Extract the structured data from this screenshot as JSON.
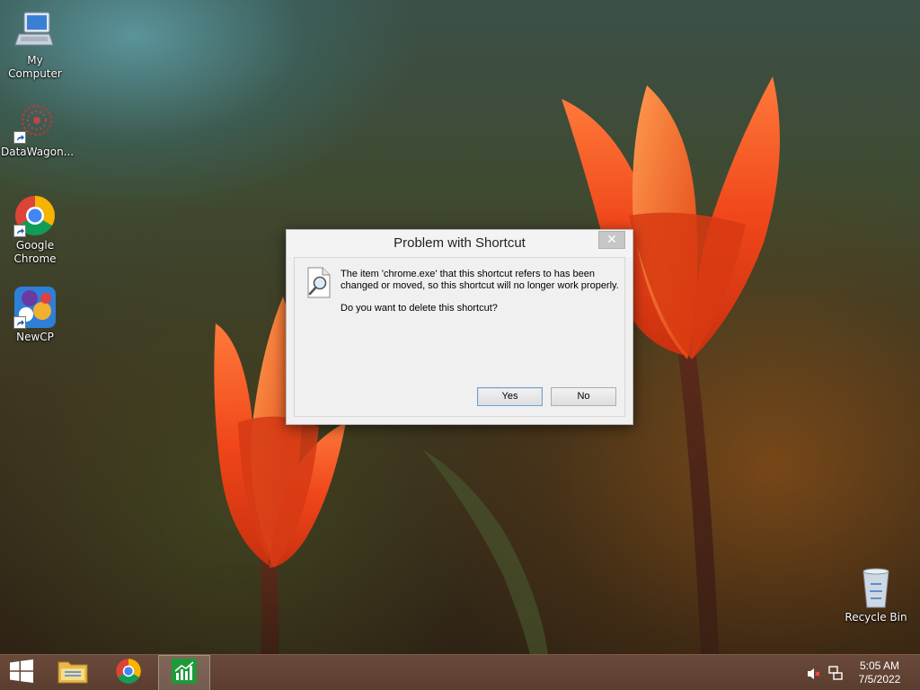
{
  "desktop": {
    "icons": [
      {
        "label": "My Computer",
        "icon": "computer-icon"
      },
      {
        "label": "DataWagon...",
        "icon": "datawagon-icon"
      },
      {
        "label": "Google Chrome",
        "icon": "chrome-icon"
      },
      {
        "label": "NewCP",
        "icon": "newcp-icon"
      },
      {
        "label": "Recycle Bin",
        "icon": "recycle-bin-icon"
      }
    ]
  },
  "dialog": {
    "title": "Problem with Shortcut",
    "close_label": "✕",
    "icon": "magnifier-document-icon",
    "message": "The item 'chrome.exe' that this shortcut refers to has been changed or moved, so this shortcut will no longer work properly.",
    "question": "Do you want to delete this shortcut?",
    "yes_label": "Yes",
    "no_label": "No"
  },
  "taskbar": {
    "items": [
      {
        "name": "start",
        "icon": "windows-logo-icon"
      },
      {
        "name": "file-explorer",
        "icon": "folder-icon"
      },
      {
        "name": "chrome",
        "icon": "chrome-icon"
      },
      {
        "name": "task-manager",
        "icon": "chart-icon",
        "active": true
      }
    ],
    "tray": {
      "volume_icon": "speaker-muted-icon",
      "network_icon": "network-icon",
      "time": "5:05 AM",
      "date": "7/5/2022"
    }
  }
}
